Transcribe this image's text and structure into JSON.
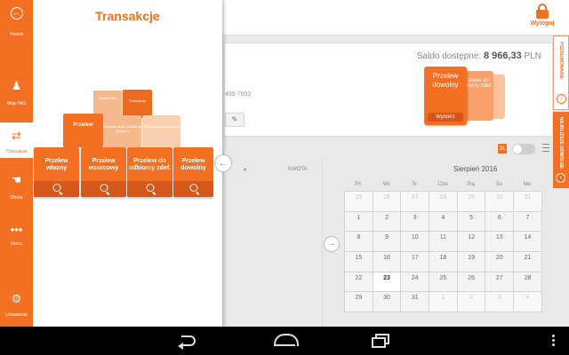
{
  "header": {
    "logout_label": "Wyloguj"
  },
  "account": {
    "saldo_label": "Saldo dostępne:",
    "saldo_value": "8 966,33",
    "currency": "PLN",
    "account_fragment": "459 7693"
  },
  "promo": {
    "main_line1": "Przelew",
    "main_line2": "dowolny",
    "choose_label": "Wybierz",
    "second_label": "Przelew do odbiorcy zdef."
  },
  "right_tabs": {
    "tab1": "PODSUMOWANIE",
    "tab2": "NAJBLIŻSZE DOWOLNE"
  },
  "list": {
    "col_amount": "KWOTA"
  },
  "calendar": {
    "month": "Sierpień 2016",
    "weekdays": [
      "Pn",
      "Wt",
      "Śr",
      "Czw",
      "Pią",
      "So",
      "Nie"
    ],
    "days": [
      [
        "25",
        "26",
        "27",
        "28",
        "29",
        "30",
        "31"
      ],
      [
        "1",
        "2",
        "3",
        "4",
        "5",
        "6",
        "7"
      ],
      [
        "8",
        "9",
        "10",
        "11",
        "12",
        "13",
        "14"
      ],
      [
        "15",
        "16",
        "17",
        "18",
        "19",
        "20",
        "21"
      ],
      [
        "22",
        "23",
        "24",
        "25",
        "26",
        "27",
        "28"
      ],
      [
        "29",
        "30",
        "31",
        "1",
        "2",
        "3",
        "4"
      ]
    ],
    "today": "23"
  },
  "drawer": {
    "title": "Transakcje",
    "rail": {
      "back": "Powrót",
      "mojeing": "Moje ING",
      "transakcje": "Transakcje",
      "oferta": "Oferta",
      "menu": "Menu",
      "ustawienia": "Ustawienia"
    },
    "small_tiles": {
      "t1": "Wpłaty ING",
      "t2": "Transakcje",
      "t3": "Przelew",
      "t4": "Zlecenie stałe/ Zasilenie telefonu",
      "t5": "Spłata karty kredytowej"
    },
    "big_tiles": [
      {
        "l1": "Przelew",
        "l2": "własny"
      },
      {
        "l1": "Przelew",
        "l2": "wzorcowy"
      },
      {
        "l1": "Przelew do",
        "l2": "odbiorcy zdef."
      },
      {
        "l1": "Przelew",
        "l2": "dowolny"
      }
    ]
  },
  "colors": {
    "accent": "#f36f21",
    "rail": "#f36f21"
  }
}
